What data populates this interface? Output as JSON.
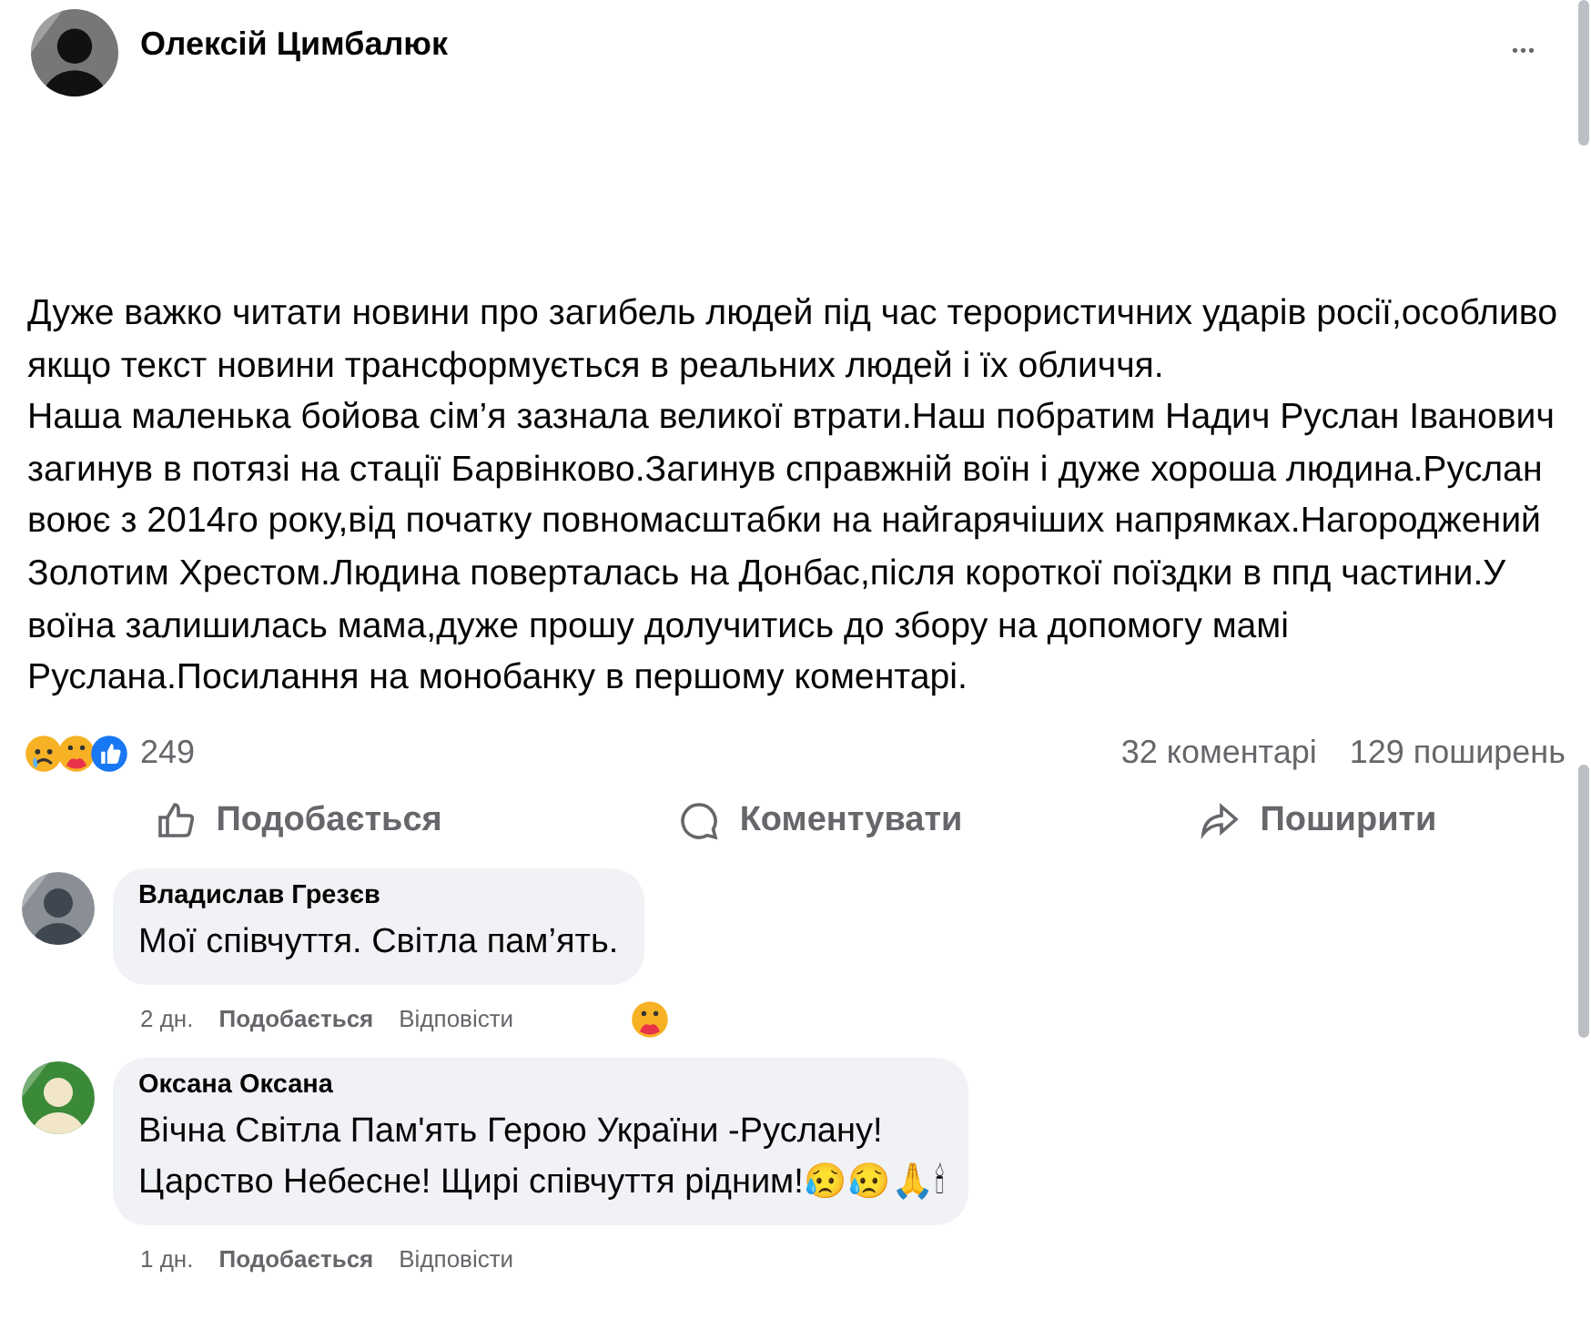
{
  "post": {
    "author": "Олексій Цимбалюк",
    "more": "•••",
    "paragraphs": [
      "Дуже важко читати новини про загибель людей під час терористичних ударів росії,особливо якщо текст новини трансформується в реальних людей і їх обличчя.",
      "Наша маленька бойова сім’я зазнала великої втрати.Наш побратим Надич Руслан Іванович загинув в потязі на стації Барвінково.Загинув справжній воїн і дуже хороша людина.Руслан воює з 2014го року,від початку повномасштабки на найгарячіших напрямках.Нагороджений Золотим Хрестом.Людина поверталась на Донбас,після короткої поїздки в ппд частини.У воїна залишилась мама,дуже прошу долучитись до збору на допомогу мамі Руслана.Посилання на монобанку в першому коментарі."
    ]
  },
  "stats": {
    "reactions": [
      {
        "kind": "sad"
      },
      {
        "kind": "care"
      },
      {
        "kind": "like"
      }
    ],
    "reaction_count": "249",
    "comments": "32 коментарі",
    "shares": "129 поширень"
  },
  "actions": [
    {
      "kind": "like",
      "label": "Подобається"
    },
    {
      "kind": "comment",
      "label": "Коментувати"
    },
    {
      "kind": "share",
      "label": "Поширити"
    }
  ],
  "comments": [
    {
      "author": "Владислав Грезєв",
      "lines": [
        "Мої співчуття. Світла пам’ять."
      ],
      "time": "2 дн.",
      "like": "Подобається",
      "reply": "Відповісти",
      "reaction": {
        "kind": "care"
      }
    },
    {
      "author": "Оксана Оксана",
      "lines": [
        "Вічна Світла Пам'ять Герою України -Руслану!",
        "Царство Небесне! Щирі співчуття рідним!😥😥🙏🕯"
      ],
      "time": "1 дн.",
      "like": "Подобається",
      "reply": "Відповісти"
    }
  ]
}
